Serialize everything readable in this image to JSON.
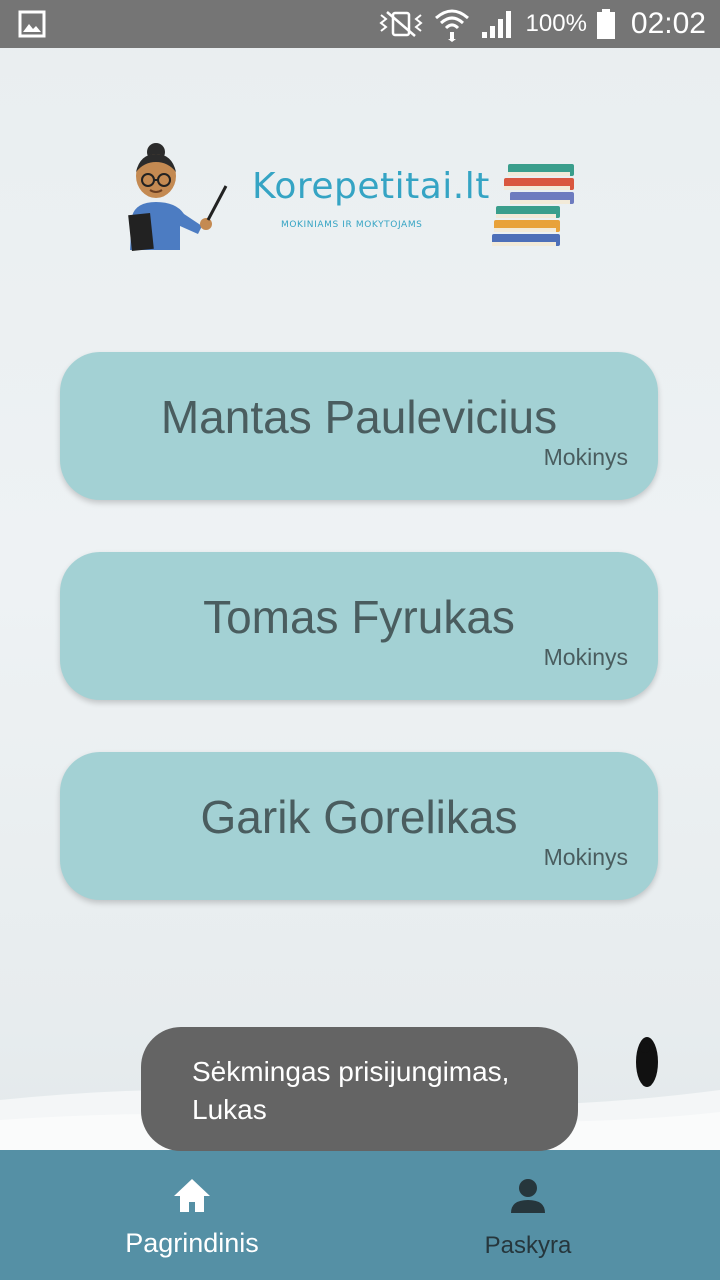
{
  "status_bar": {
    "battery_text": "100%",
    "clock": "02:02",
    "icons": [
      "gallery-icon",
      "vibrate-icon",
      "wifi-icon",
      "signal-icon",
      "battery-icon"
    ]
  },
  "header": {
    "logo_text": "Korepetitai.lt",
    "tagline": "MOKINIAMS IR MOKYTOJAMS"
  },
  "students": [
    {
      "name": "Mantas Paulevicius",
      "role": "Mokinys"
    },
    {
      "name": "Tomas Fyrukas",
      "role": "Mokinys"
    },
    {
      "name": "Garik Gorelikas",
      "role": "Mokinys"
    }
  ],
  "toast": {
    "message": "Sėkmingas prisijungimas, Lukas"
  },
  "bottom_nav": {
    "items": [
      {
        "label": "Pagrindinis",
        "icon": "home-icon",
        "active": true
      },
      {
        "label": "Paskyra",
        "icon": "person-icon",
        "active": false
      }
    ]
  },
  "colors": {
    "card": "#a3d1d4",
    "nav": "#5590a5",
    "logo": "#35a4c4",
    "toast": "#646464"
  }
}
